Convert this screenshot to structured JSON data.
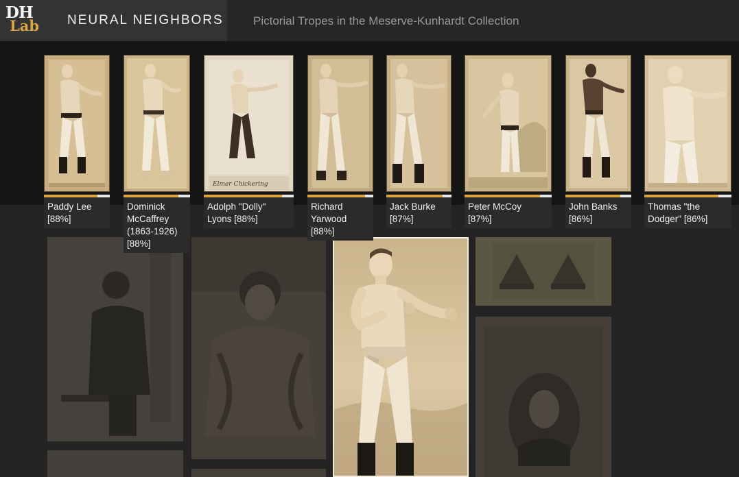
{
  "header": {
    "logo_top": "DH",
    "logo_bottom": "Lab",
    "title": "NEURAL NEIGHBORS",
    "subtitle": "Pictorial Tropes in the Meserve-Kunhardt Collection"
  },
  "colors": {
    "accent": "#d9a441",
    "header_bg": "#262626",
    "brand_bg": "#333333",
    "page_bg": "#1c1c1c"
  },
  "neighbors": [
    {
      "caption": "Paddy Lee [88%]",
      "similarity": 0.88
    },
    {
      "caption": "Dominick McCaffrey (1863-1926) [88%]",
      "similarity": 0.88
    },
    {
      "caption": "Adolph \"Dolly\" Lyons [88%]",
      "similarity": 0.88
    },
    {
      "caption": "Richard Yarwood [88%]",
      "similarity": 0.88
    },
    {
      "caption": "Jack Burke [87%]",
      "similarity": 0.87
    },
    {
      "caption": "Peter McCoy [87%]",
      "similarity": 0.87
    },
    {
      "caption": "John Banks [86%]",
      "similarity": 0.86
    },
    {
      "caption": "Thomas \"the Dodger\" [86%]",
      "similarity": 0.86
    }
  ]
}
